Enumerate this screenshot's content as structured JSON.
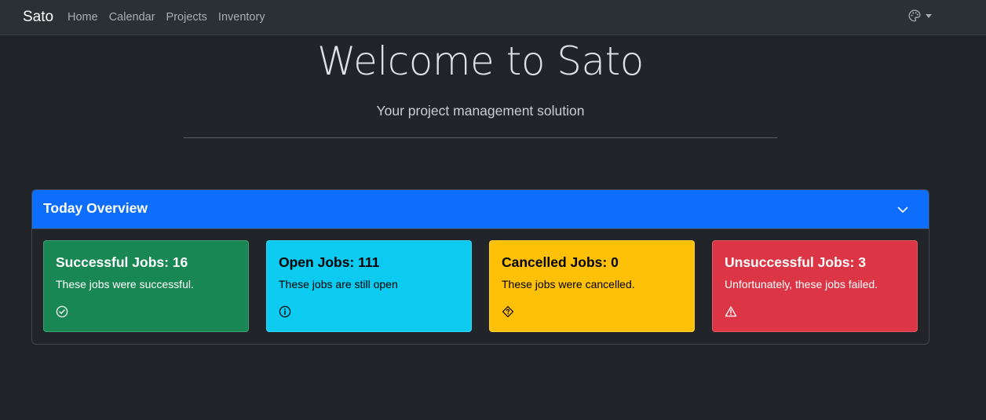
{
  "navbar": {
    "brand": "Sato",
    "links": [
      "Home",
      "Calendar",
      "Projects",
      "Inventory"
    ],
    "theme_icon": "palette-icon"
  },
  "hero": {
    "title": "Welcome to Sato",
    "subtitle": "Your project management solution"
  },
  "overview": {
    "title": "Today Overview",
    "collapse_icon": "chevron-down-icon",
    "tiles": [
      {
        "title": "Successful Jobs: 16",
        "text": "These jobs were successful.",
        "icon": "check-circle-icon",
        "color": "#198754"
      },
      {
        "title": "Open Jobs: 111",
        "text": "These jobs are still open",
        "icon": "info-circle-icon",
        "color": "#0dcaf0"
      },
      {
        "title": "Cancelled Jobs: 0",
        "text": "These jobs were cancelled.",
        "icon": "sign-question-icon",
        "color": "#ffc107"
      },
      {
        "title": "Unsuccessful Jobs: 3",
        "text": "Unfortunately, these jobs failed.",
        "icon": "warning-triangle-icon",
        "color": "#dc3545"
      }
    ]
  },
  "colors": {
    "background": "#212529",
    "navbar": "#2b3035",
    "primary": "#0d6efd"
  }
}
